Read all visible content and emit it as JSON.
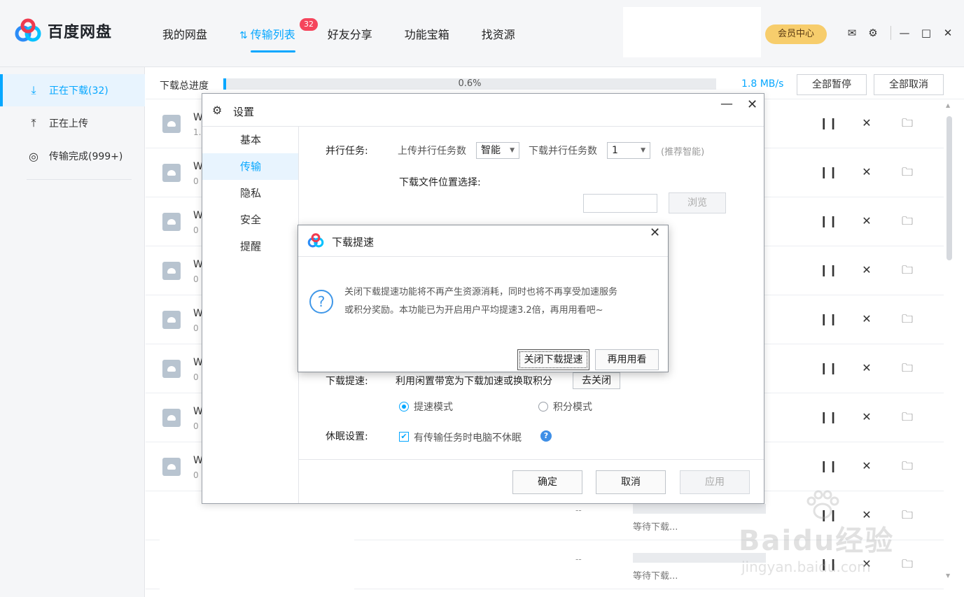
{
  "app": {
    "name": "百度网盘"
  },
  "header": {
    "nav": [
      {
        "label": "我的网盘"
      },
      {
        "label": "传输列表",
        "badge": "32"
      },
      {
        "label": "好友分享"
      },
      {
        "label": "功能宝箱"
      },
      {
        "label": "找资源"
      }
    ],
    "vip_label": "会员中心"
  },
  "sidebar": {
    "items": [
      {
        "label": "正在下载(32)"
      },
      {
        "label": "正在上传"
      },
      {
        "label": "传输完成(999+)"
      }
    ]
  },
  "transfer_bar": {
    "total_label": "下载总进度",
    "progress_text": "0.6%",
    "progress_fraction": 0.006,
    "speed": "1.8 MB/s",
    "pause_all": "全部暂停",
    "cancel_all": "全部取消"
  },
  "rows": [
    {
      "name": "W",
      "sub": "1."
    },
    {
      "name": "W",
      "sub": "0"
    },
    {
      "name": "W",
      "sub": "0"
    },
    {
      "name": "W",
      "sub": "0"
    },
    {
      "name": "W",
      "sub": "0"
    },
    {
      "name": "W",
      "sub": "0"
    },
    {
      "name": "W",
      "sub": "0"
    },
    {
      "name": "W",
      "sub": "0"
    }
  ],
  "waiting_rows": [
    {
      "dash": "--",
      "status": "等待下载..."
    },
    {
      "dash": "--",
      "status": "等待下载..."
    }
  ],
  "settings": {
    "title": "设置",
    "nav": [
      {
        "label": "基本"
      },
      {
        "label": "传输"
      },
      {
        "label": "隐私"
      },
      {
        "label": "安全"
      },
      {
        "label": "提醒"
      }
    ],
    "parallel_label": "并行任务:",
    "upload_parallel_label": "上传并行任务数",
    "upload_parallel_value": "智能",
    "download_parallel_label": "下载并行任务数",
    "download_parallel_value": "1",
    "recommend_hint": "(推荐智能)",
    "download_location_label": "下载文件位置选择:",
    "browse_label": "浏览",
    "speedup_label": "下载提速:",
    "speedup_desc": "利用闲置带宽为下载加速或换取积分",
    "speedup_off_btn": "去关闭",
    "mode_speed": "提速模式",
    "mode_points": "积分模式",
    "sleep_label": "休眠设置:",
    "sleep_option": "有传输任务时电脑不休眠",
    "ok": "确定",
    "cancel": "取消",
    "apply": "应用"
  },
  "speed_dialog": {
    "title": "下载提速",
    "message_line1": "关闭下载提速功能将不再产生资源消耗，同时也将不再享受加速服务",
    "message_line2": "或积分奖励。本功能已为开启用户平均提速3.2倍，再用用看吧~",
    "close_btn": "关闭下载提速",
    "retry_btn": "再用用看"
  },
  "watermark": {
    "main": "Baidu经验",
    "sub": "jingyan.baidu.com"
  },
  "colors": {
    "accent": "#06a7ff",
    "vip": "#f7cd6c",
    "badge": "#f5455c"
  }
}
